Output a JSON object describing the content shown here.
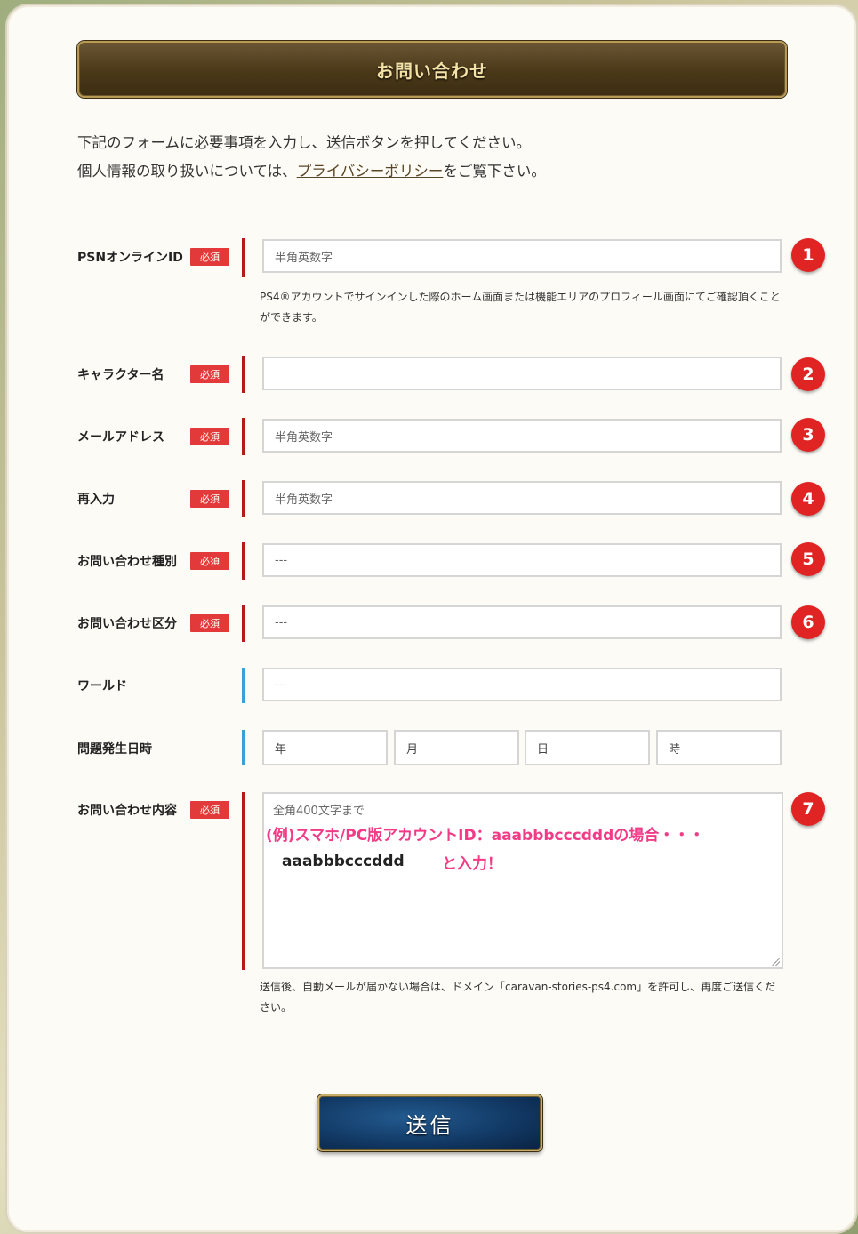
{
  "header": {
    "title": "お問い合わせ"
  },
  "intro": {
    "line1": "下記のフォームに必要事項を入力し、送信ボタンを押してください。",
    "line2_before": "個人情報の取り扱いについては、",
    "line2_link": "プライバシーポリシー",
    "line2_after": "をご覧下さい。"
  },
  "required_label": "必須",
  "fields": {
    "psn": {
      "label": "PSNオンラインID",
      "placeholder": "半角英数字",
      "hint": "PS4®アカウントでサインインした際のホーム画面または機能エリアのプロフィール画面にてご確認頂くことができます。",
      "badge": "1"
    },
    "character": {
      "label": "キャラクター名",
      "value": "",
      "badge": "2"
    },
    "email": {
      "label": "メールアドレス",
      "placeholder": "半角英数字",
      "badge": "3"
    },
    "reenter": {
      "label": "再入力",
      "placeholder": "半角英数字",
      "badge": "4"
    },
    "type": {
      "label": "お問い合わせ種別",
      "value": "---",
      "badge": "5"
    },
    "category": {
      "label": "お問い合わせ区分",
      "value": "---",
      "badge": "6"
    },
    "world": {
      "label": "ワールド",
      "value": "---"
    },
    "datetime": {
      "label": "問題発生日時",
      "year": "年",
      "month": "月",
      "day": "日",
      "hour": "時"
    },
    "content": {
      "label": "お問い合わせ内容",
      "placeholder": "全角400文字まで",
      "example_line": "(例)スマホ/PC版アカウントID：aaabbbcccdddの場合・・・",
      "example_value": "aaabbbcccddd",
      "example_instruction": "と入力！",
      "hint": "送信後、自動メールが届かない場合は、ドメイン「caravan-stories-ps4.com」を許可し、再度ご送信ください。",
      "badge": "7"
    }
  },
  "submit": {
    "label": "送信"
  }
}
